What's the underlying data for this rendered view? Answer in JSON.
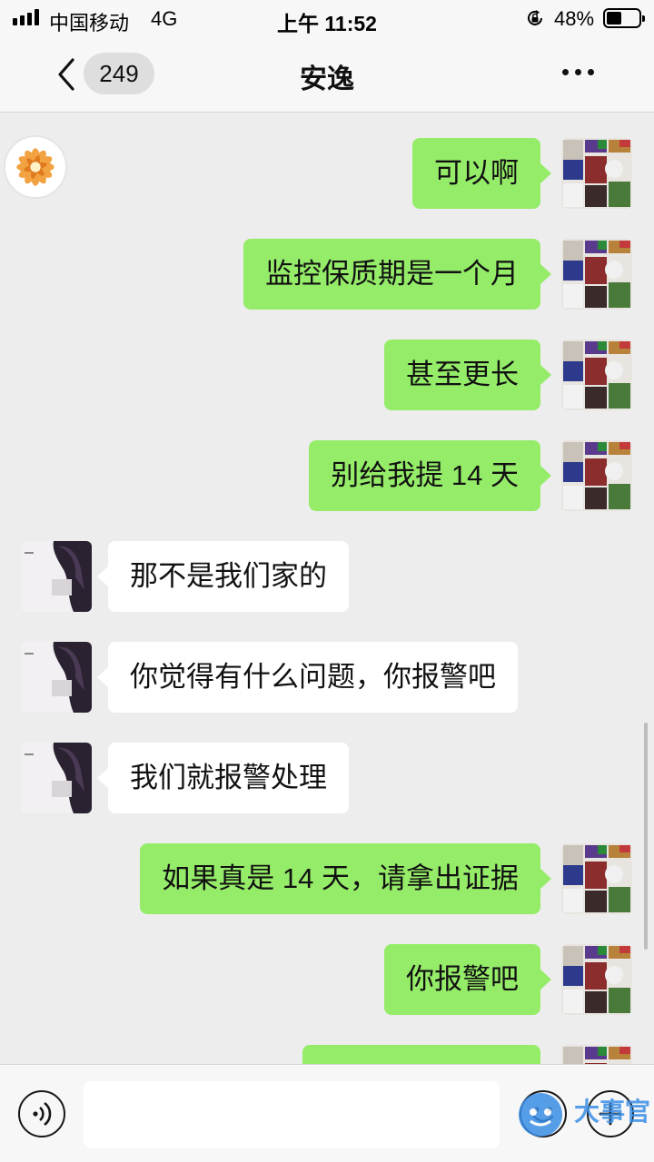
{
  "status_bar": {
    "carrier": "中国移动",
    "network": "4G",
    "time": "上午 11:52",
    "battery_percent": "48%",
    "battery_level": 0.48
  },
  "nav": {
    "unread_count": "249",
    "title": "安逸"
  },
  "messages": [
    {
      "side": "out",
      "text": "可以啊"
    },
    {
      "side": "out",
      "text": "监控保质期是一个月"
    },
    {
      "side": "out",
      "text": "甚至更长"
    },
    {
      "side": "out",
      "text": "别给我提 14 天"
    },
    {
      "side": "in",
      "text": "那不是我们家的"
    },
    {
      "side": "in",
      "text": "你觉得有什么问题，你报警吧"
    },
    {
      "side": "in",
      "text": "我们就报警处理"
    },
    {
      "side": "out",
      "text": "如果真是 14 天，请拿出证据"
    },
    {
      "side": "out",
      "text": "你报警吧"
    },
    {
      "side": "out",
      "text": ""
    }
  ],
  "input": {
    "value": "",
    "placeholder": ""
  },
  "watermark": {
    "text": "大事官"
  },
  "colors": {
    "outgoing_bubble": "#95ec69",
    "incoming_bubble": "#ffffff",
    "background": "#ededed",
    "bar": "#f7f7f7"
  },
  "icons": [
    "signal-icon",
    "rotation-lock-icon",
    "battery-icon",
    "back-icon",
    "more-icon",
    "voice-icon",
    "emoji-icon",
    "plus-icon"
  ]
}
